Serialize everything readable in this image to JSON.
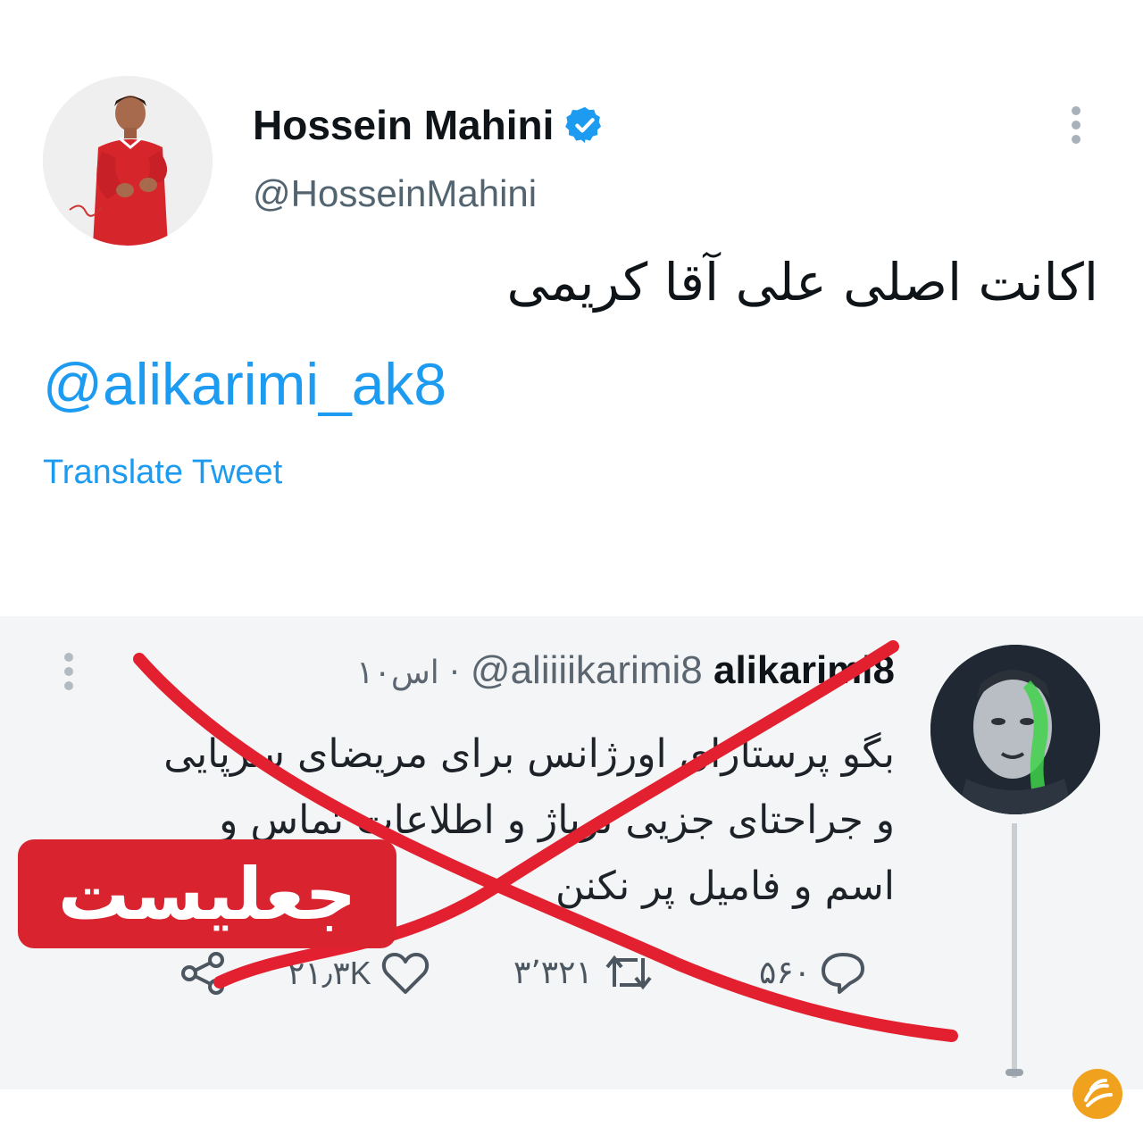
{
  "tweet": {
    "display_name": "Hossein Mahini",
    "handle": "@HosseinMahini",
    "text": "اکانت اصلی علی آقا کریمی",
    "mention": "@alikarimi_ak8",
    "translate_label": "Translate Tweet"
  },
  "embedded_tweet": {
    "display_name": "alikarimi8",
    "handle": "@aliiiikarimi8",
    "time": "۱۰اس ·",
    "text_lines": [
      "بگو پرستارای اورژانس برای مریضای سرپایی",
      "و جراحتای جزیی ترياژ و اطلاعات تماس و",
      "اسم و فامیل پر نکنن"
    ],
    "replies": "۵۶۰",
    "retweets": "۳٬۳۲۱",
    "likes": "۲۱٫۳K"
  },
  "badge": {
    "label": "جعلیست",
    "color": "#d9232f"
  },
  "icons": {
    "verified": "verified-badge-icon",
    "more": "more-vertical-icon",
    "reply": "reply-icon",
    "retweet": "retweet-icon",
    "like": "heart-icon",
    "share": "share-icon",
    "watermark": "site-logo-icon"
  },
  "colors": {
    "link": "#1d9bf0",
    "cross": "#e3202f",
    "watermark": "#f0a21f"
  }
}
